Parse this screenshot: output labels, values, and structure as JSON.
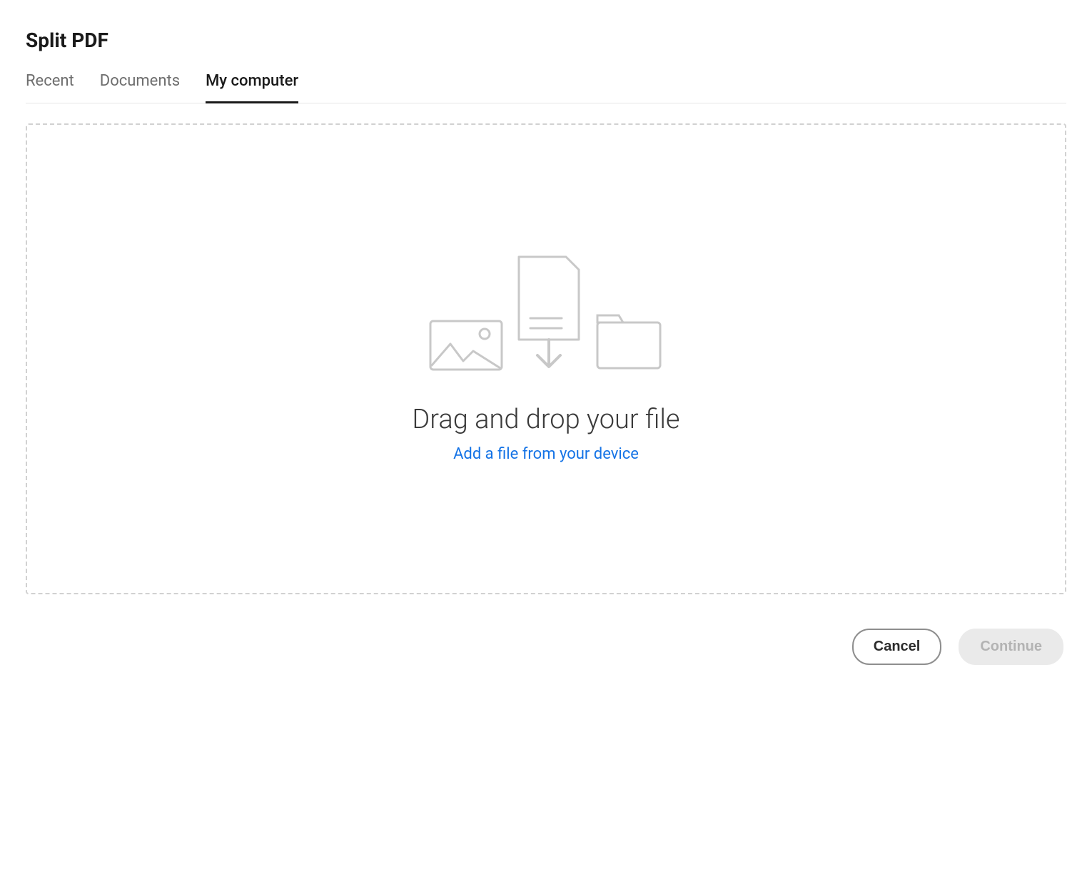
{
  "title": "Split PDF",
  "tabs": [
    {
      "label": "Recent",
      "active": false
    },
    {
      "label": "Documents",
      "active": false
    },
    {
      "label": "My computer",
      "active": true
    }
  ],
  "dropzone": {
    "heading": "Drag and drop your file",
    "link": "Add a file from your device"
  },
  "footer": {
    "cancel": "Cancel",
    "continue": "Continue"
  },
  "colors": {
    "link": "#1473e6",
    "icon_stroke": "#c8c8c8"
  }
}
